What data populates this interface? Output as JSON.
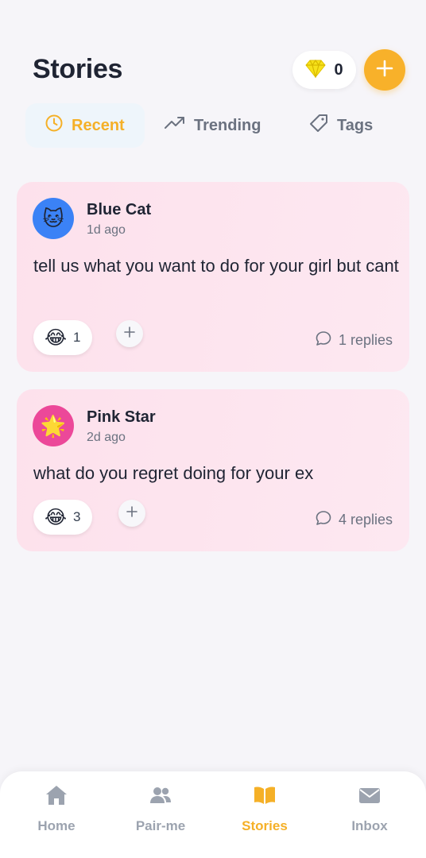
{
  "header": {
    "title": "Stories",
    "gem_count": "0"
  },
  "tabs": [
    {
      "label": "Recent",
      "active": true,
      "icon": "clock-icon"
    },
    {
      "label": "Trending",
      "active": false,
      "icon": "trending-up-icon"
    },
    {
      "label": "Tags",
      "active": false,
      "icon": "tag-icon"
    }
  ],
  "posts": [
    {
      "author": "Blue Cat",
      "time": "1d ago",
      "avatar_emoji": "🐱",
      "avatar_color": "#3b82f6",
      "text": "tell us what you want to do for your girl but cant",
      "reaction_emoji": "😂",
      "reaction_count": "1",
      "replies": "1 replies"
    },
    {
      "author": "Pink Star",
      "time": "2d ago",
      "avatar_emoji": "🌟",
      "avatar_color": "#ec4899",
      "text": "what do you regret doing for your ex",
      "reaction_emoji": "😂",
      "reaction_count": "3",
      "replies": "4 replies"
    }
  ],
  "nav": [
    {
      "label": "Home",
      "icon": "home-icon",
      "active": false
    },
    {
      "label": "Pair-me",
      "icon": "users-icon",
      "active": false
    },
    {
      "label": "Stories",
      "icon": "book-open-icon",
      "active": true
    },
    {
      "label": "Inbox",
      "icon": "mail-icon",
      "active": false
    }
  ],
  "colors": {
    "accent": "#f8b12a",
    "background": "#f6f5f9",
    "card": "#fde4ee"
  }
}
